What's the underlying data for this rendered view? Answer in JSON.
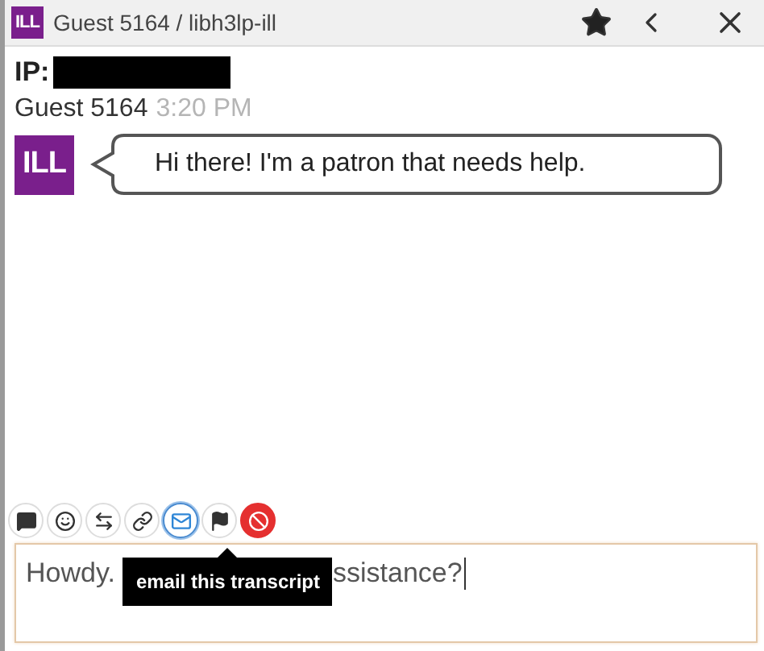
{
  "window": {
    "badge": "ILL",
    "title": "Guest 5164 / libh3lp-ill"
  },
  "info": {
    "ip_label": "IP:"
  },
  "messages": [
    {
      "sender": "Guest 5164",
      "time": "3:20 PM",
      "avatar": "ILL",
      "text": "Hi there! I'm a patron that needs help."
    }
  ],
  "toolbar": [
    {
      "kind": "chat",
      "selected": false
    },
    {
      "kind": "face",
      "selected": false
    },
    {
      "kind": "transfer",
      "selected": false
    },
    {
      "kind": "link",
      "selected": false
    },
    {
      "kind": "email",
      "selected": true
    },
    {
      "kind": "flag",
      "selected": false
    },
    {
      "kind": "ban",
      "selected": false
    }
  ],
  "tooltip": "email this transcript",
  "composer": {
    "value_start": "Howdy.",
    "value_end": "ssistance?"
  }
}
